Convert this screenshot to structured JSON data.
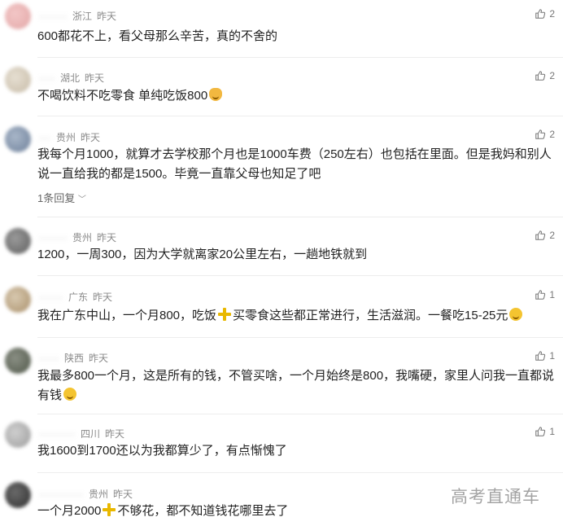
{
  "comments": [
    {
      "location": "浙江",
      "time": "昨天",
      "text": "600都花不上，看父母那么辛苦，真的不舍的",
      "likes": "2",
      "avatar_colors": [
        "#f3c7c7",
        "#e2a6a6"
      ]
    },
    {
      "location": "湖北",
      "time": "昨天",
      "text": "不喝饮料不吃零食 单纯吃饭800",
      "likes": "2",
      "emoji": "cat-emoji",
      "avatar_colors": [
        "#e6dfd2",
        "#c7bba7"
      ]
    },
    {
      "location": "贵州",
      "time": "昨天",
      "text": "我每个月1000，就算才去学校那个月也是1000车费（250左右）也包括在里面。但是我妈和别人说一直给我的都是1500。毕竟一直靠父母也知足了吧",
      "likes": "2",
      "reply_text": "1条回复",
      "avatar_colors": [
        "#a9b7c9",
        "#6d7f99"
      ]
    },
    {
      "location": "贵州",
      "time": "昨天",
      "text": "1200，一周300，因为大学就离家20公里左右，一趟地铁就到",
      "likes": "2",
      "avatar_colors": [
        "#9a9a9a",
        "#5e5e5e"
      ]
    },
    {
      "location": "广东",
      "time": "昨天",
      "text_parts": [
        "我在广东中山，一个月800，吃饭",
        "买零食这些都正常进行，生活滋润。一餐吃15-25元"
      ],
      "likes": "1",
      "emoji": "smile-emoji",
      "avatar_colors": [
        "#d8c9b0",
        "#a98f6a"
      ]
    },
    {
      "location": "陕西",
      "time": "昨天",
      "text": "我最多800一个月，这是所有的钱，不管买啥，一个月始终是800，我嘴硬，家里人问我一直都说有钱",
      "likes": "1",
      "emoji": "wave-emoji",
      "avatar_colors": [
        "#8a8f84",
        "#4f5648"
      ]
    },
    {
      "location": "四川",
      "time": "昨天",
      "text": "我1600到1700还以为我都算少了，有点惭愧了",
      "likes": "1",
      "avatar_colors": [
        "#cfcfcf",
        "#9c9c9c"
      ]
    },
    {
      "location": "贵州",
      "time": "昨天",
      "text_parts": [
        "一个月2000",
        "不够花，都不知道钱花哪里去了"
      ],
      "likes": "",
      "avatar_colors": [
        "#6a6a6a",
        "#2e2e2e"
      ]
    }
  ],
  "watermark": "高考直通车",
  "colors": {
    "plus_icon": "#e9b800",
    "meta_text": "#8a8a8a"
  }
}
